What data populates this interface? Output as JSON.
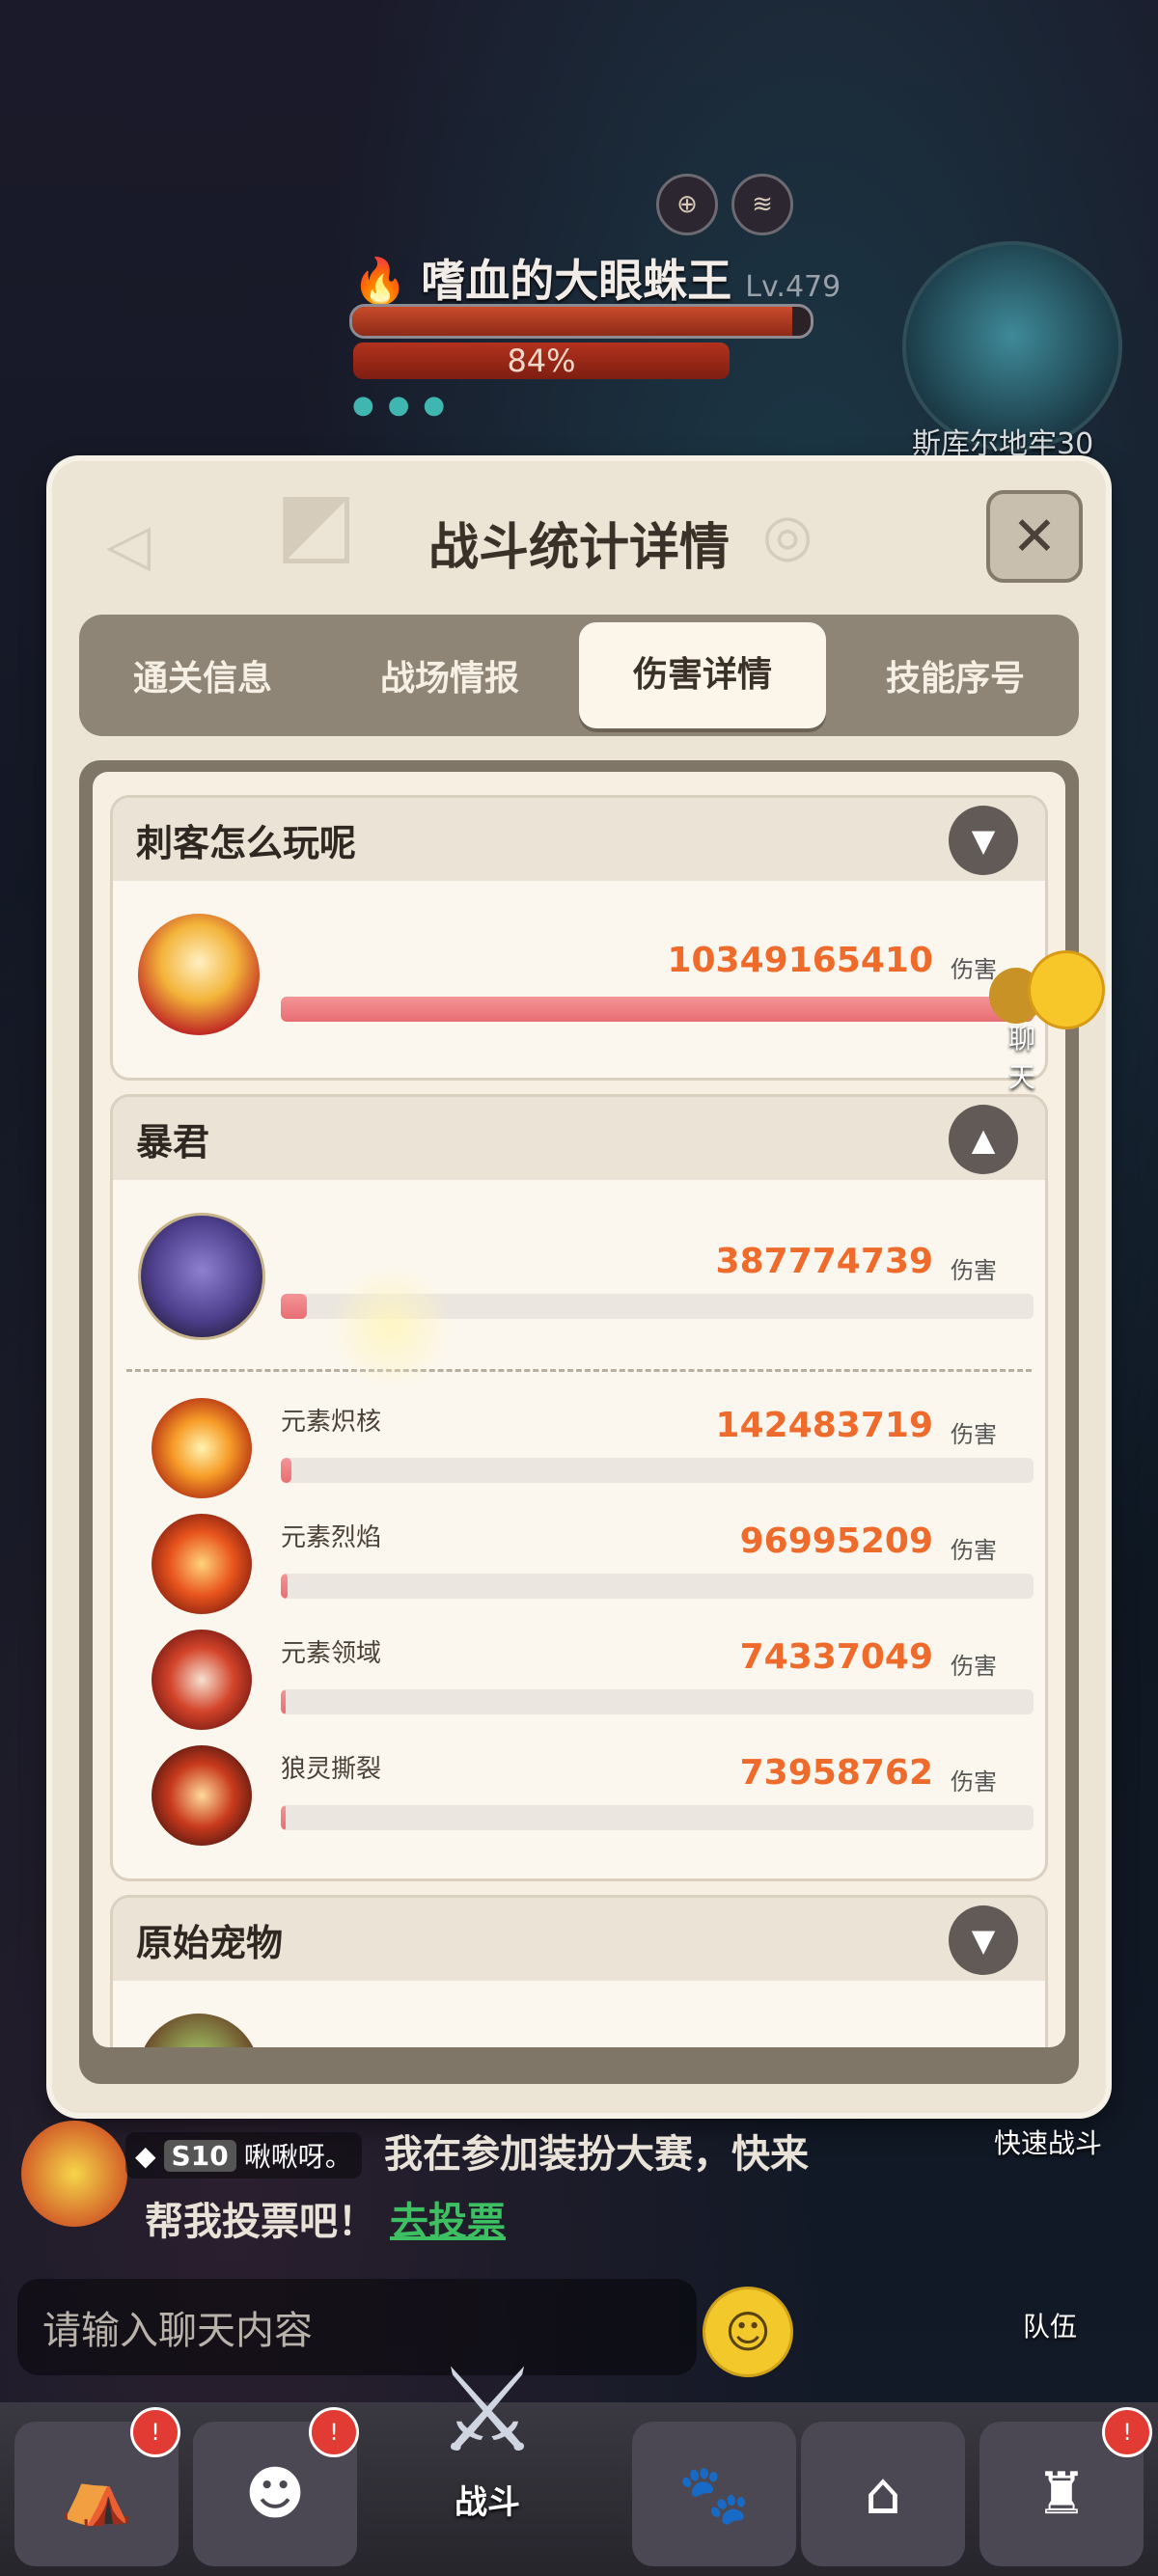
{
  "boss": {
    "name": "嗜血的大眼蛛王",
    "level": "Lv.479",
    "hp_percent_label": "84%",
    "hp_fraction": 0.84
  },
  "map": {
    "label": "斯库尔地牢30"
  },
  "panel": {
    "title": "战斗统计详情",
    "tabs": [
      "通关信息",
      "战场情报",
      "伤害详情",
      "技能序号"
    ],
    "active_tab": 2
  },
  "dmg_unit": "伤害",
  "groups": {
    "assassin": {
      "title": "刺客怎么玩呢",
      "hero": {
        "damage": "10349165410",
        "fraction": 1.0
      }
    },
    "tyrant": {
      "title": "暴君",
      "hero": {
        "damage": "387774739",
        "fraction": 0.037
      },
      "skills": [
        {
          "name": "元素炽核",
          "damage": "142483719",
          "fraction": 0.014,
          "icon": "fire-core-icon"
        },
        {
          "name": "元素烈焰",
          "damage": "96995209",
          "fraction": 0.009,
          "icon": "flame-icon"
        },
        {
          "name": "元素领域",
          "damage": "74337049",
          "fraction": 0.007,
          "icon": "fire-domain-icon"
        },
        {
          "name": "狼灵撕裂",
          "damage": "73958762",
          "fraction": 0.007,
          "icon": "claw-icon"
        }
      ]
    },
    "pet": {
      "title": "原始宠物"
    }
  },
  "chat_mascot_label": "聊天",
  "chat": {
    "level_tag": "S10",
    "user": "啾啾呀。",
    "message_line1": "我在参加装扮大赛，快来",
    "message_line2": "帮我投票吧！",
    "vote_link": "去投票",
    "input_placeholder": "请输入聊天内容"
  },
  "side": {
    "quick_battle": "快速战斗",
    "team": "队伍"
  },
  "nav": {
    "battle": "战斗"
  },
  "colors": {
    "damage": "#ef6b2c",
    "bar_fill": "#e86e73",
    "vote_link": "#3cc062"
  }
}
